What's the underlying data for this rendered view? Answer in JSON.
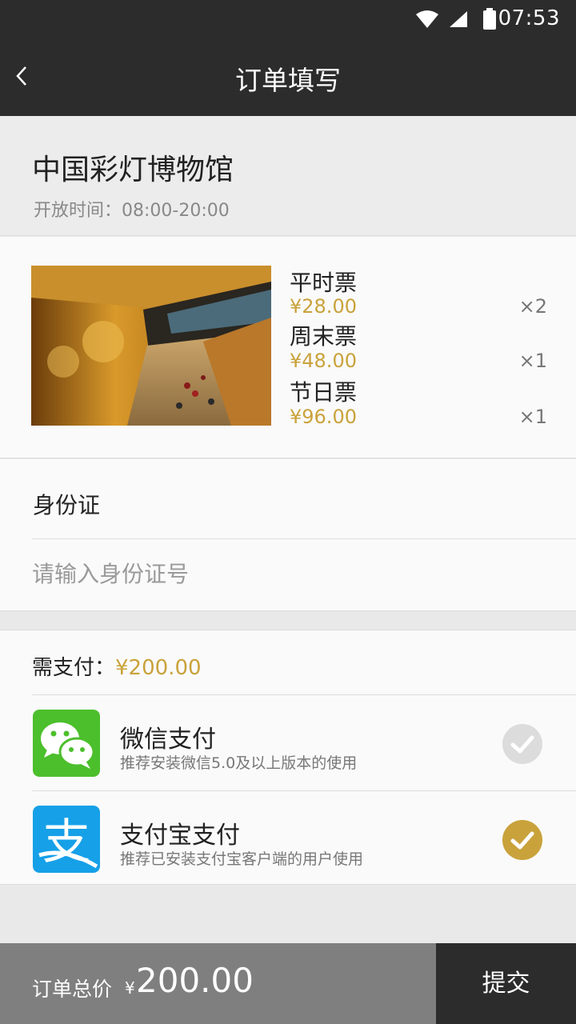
{
  "status_bar": {
    "time": "07:53"
  },
  "header": {
    "title": "订单填写"
  },
  "venue": {
    "name": "中国彩灯博物馆",
    "hours": "开放时间：08:00-20:00"
  },
  "tickets": [
    {
      "name": "平时票",
      "price": "¥28.00",
      "qty": "×2"
    },
    {
      "name": "周末票",
      "price": "¥48.00",
      "qty": "×1"
    },
    {
      "name": "节日票",
      "price": "¥96.00",
      "qty": "×1"
    }
  ],
  "id_card": {
    "label": "身份证",
    "placeholder": "请输入身份证号",
    "value": ""
  },
  "payment": {
    "required_label": "需支付：",
    "required_amount": "¥200.00",
    "methods": [
      {
        "name": "微信支付",
        "desc": "推荐安装微信5.0及以上版本的使用",
        "icon": "wechat-icon",
        "selected": false
      },
      {
        "name": "支付宝支付",
        "desc": "推荐已安装支付宝客户端的用户使用",
        "icon": "alipay-icon",
        "selected": true
      }
    ]
  },
  "footer": {
    "total_label": "订单总价",
    "currency": "¥",
    "total": "200.00",
    "submit_label": "提交"
  },
  "colors": {
    "accent": "#c9a23b",
    "header_bg": "#2c2c2c",
    "wechat_green": "#4cbf2c",
    "alipay_blue": "#16a0e8"
  }
}
